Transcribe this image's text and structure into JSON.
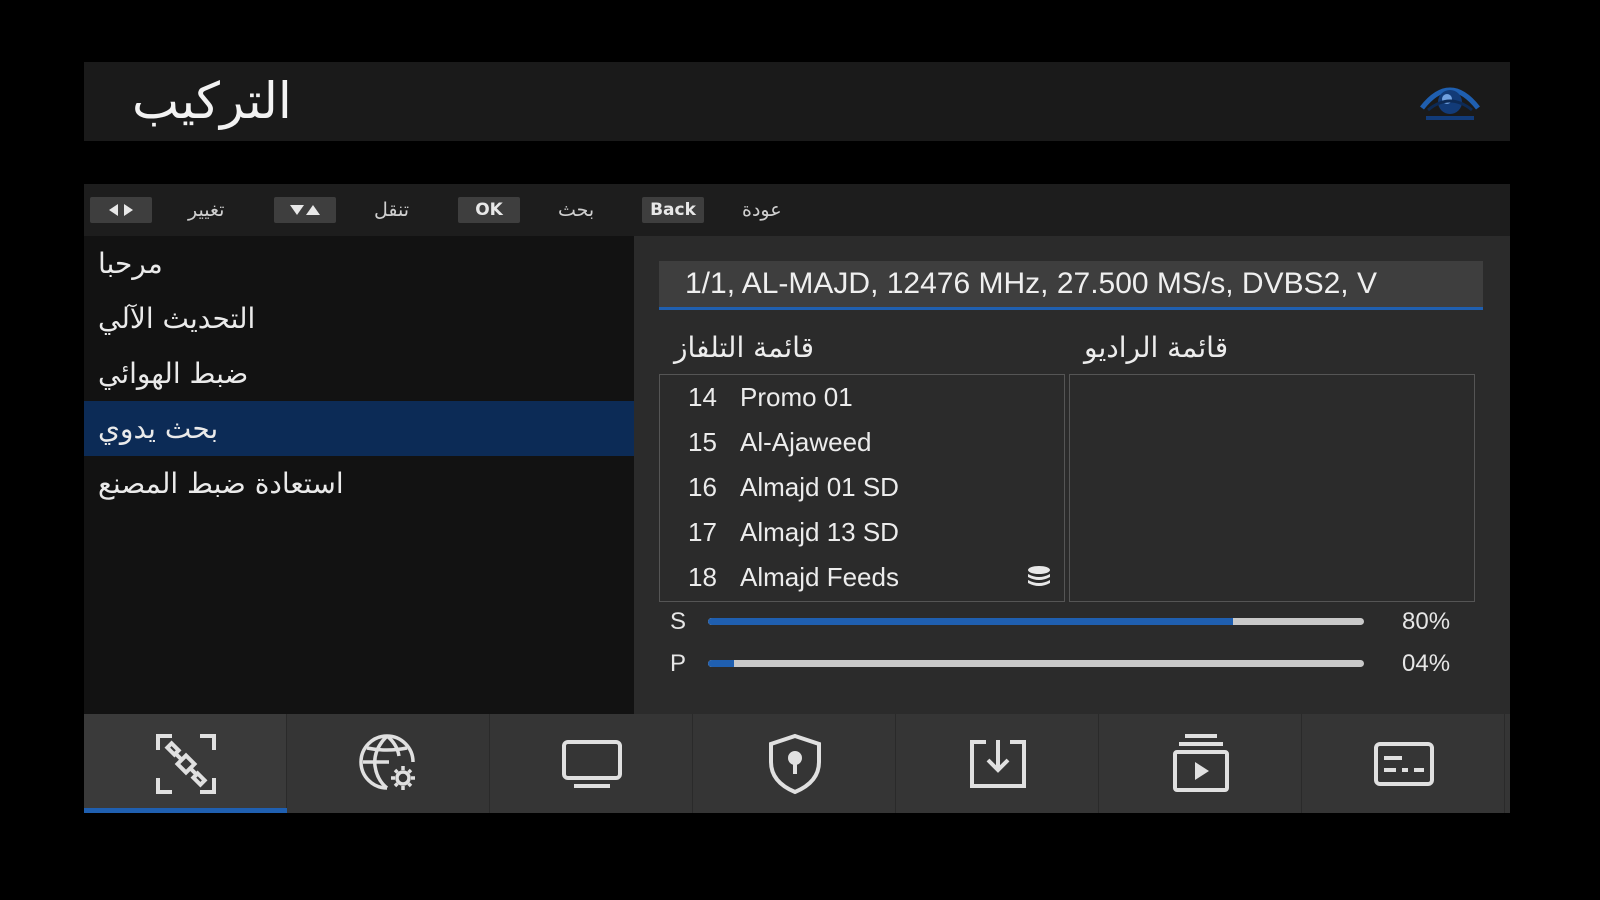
{
  "header": {
    "title": "التركيب",
    "logo_icon": "eye-globe-logo-icon"
  },
  "hints": [
    {
      "key_icon": "left-right-arrows-icon",
      "key_label": "",
      "label": "تغيير"
    },
    {
      "key_icon": "up-down-arrows-icon",
      "key_label": "",
      "label": "تنقل"
    },
    {
      "key_icon": "",
      "key_label": "OK",
      "label": "بحث"
    },
    {
      "key_icon": "",
      "key_label": "Back",
      "label": "عودة"
    }
  ],
  "menu": {
    "items": [
      {
        "label": "مرحبا"
      },
      {
        "label": "التحديث الآلي"
      },
      {
        "label": "ضبط الهوائي"
      },
      {
        "label": "بحث يدوي"
      },
      {
        "label": "استعادة ضبط المصنع"
      }
    ],
    "selected_index": 3
  },
  "transponder": {
    "value": "1/1, AL-MAJD, 12476 MHz, 27.500 MS/s, DVBS2, V"
  },
  "tv_list": {
    "title": "قائمة التلفاز",
    "channels": [
      {
        "num": "14",
        "name": "Promo 01"
      },
      {
        "num": "15",
        "name": "Al-Ajaweed"
      },
      {
        "num": "16",
        "name": "Almajd 01 SD"
      },
      {
        "num": "17",
        "name": "Almajd 13 SD"
      },
      {
        "num": "18",
        "name": "Almajd Feeds",
        "icon": "database-icon"
      }
    ]
  },
  "radio_list": {
    "title": "قائمة الراديو",
    "channels": []
  },
  "meters": {
    "strength": {
      "label": "S",
      "value_text": "80%",
      "fraction": 0.8
    },
    "quality": {
      "label": "P",
      "value_text": "04%",
      "fraction": 0.04
    }
  },
  "bottom_tabs": [
    {
      "icon": "satellite-scan-icon",
      "active": true
    },
    {
      "icon": "globe-settings-icon",
      "active": false
    },
    {
      "icon": "tv-monitor-icon",
      "active": false
    },
    {
      "icon": "shield-lock-icon",
      "active": false
    },
    {
      "icon": "download-icon",
      "active": false
    },
    {
      "icon": "media-player-icon",
      "active": false
    },
    {
      "icon": "subtitles-icon",
      "active": false
    }
  ],
  "colors": {
    "accent": "#1f5fb0",
    "selected_row": "#0c2b56",
    "panel": "#2b2b2b"
  }
}
